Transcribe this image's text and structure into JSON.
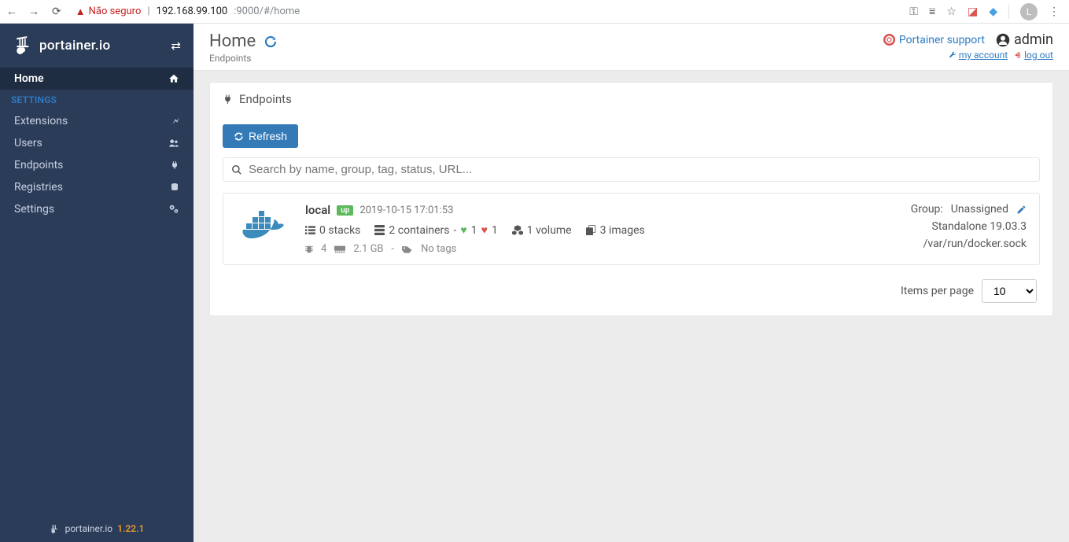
{
  "browser": {
    "warn_label": "Não seguro",
    "url_host": "192.168.99.100",
    "url_port_path": ":9000/#/home",
    "avatar_letter": "L"
  },
  "brand": {
    "name": "portainer.io",
    "footer_name": "portainer.io",
    "version": "1.22.1"
  },
  "sidebar": {
    "home": "Home",
    "settings_header": "SETTINGS",
    "items": [
      {
        "label": "Extensions"
      },
      {
        "label": "Users"
      },
      {
        "label": "Endpoints"
      },
      {
        "label": "Registries"
      },
      {
        "label": "Settings"
      }
    ]
  },
  "header": {
    "title": "Home",
    "subtitle": "Endpoints",
    "support": "Portainer support",
    "username": "admin",
    "my_account": "my account",
    "log_out": "log out"
  },
  "endpoints": {
    "title": "Endpoints",
    "refresh": "Refresh",
    "search_placeholder": "Search by name, group, tag, status, URL...",
    "items_per_page_label": "Items per page",
    "items_per_page_value": "10"
  },
  "endpoint": {
    "name": "local",
    "status": "up",
    "timestamp": "2019-10-15 17:01:53",
    "stacks": "0 stacks",
    "containers": "2 containers",
    "healthy": "1",
    "unhealthy": "1",
    "volumes": "1 volume",
    "images": "3 images",
    "cpu": "4",
    "memory": "2.1 GB",
    "sep": "-",
    "no_tags": "No tags",
    "group_label": "Group:",
    "group_value": "Unassigned",
    "mode": "Standalone 19.03.3",
    "socket": "/var/run/docker.sock"
  }
}
